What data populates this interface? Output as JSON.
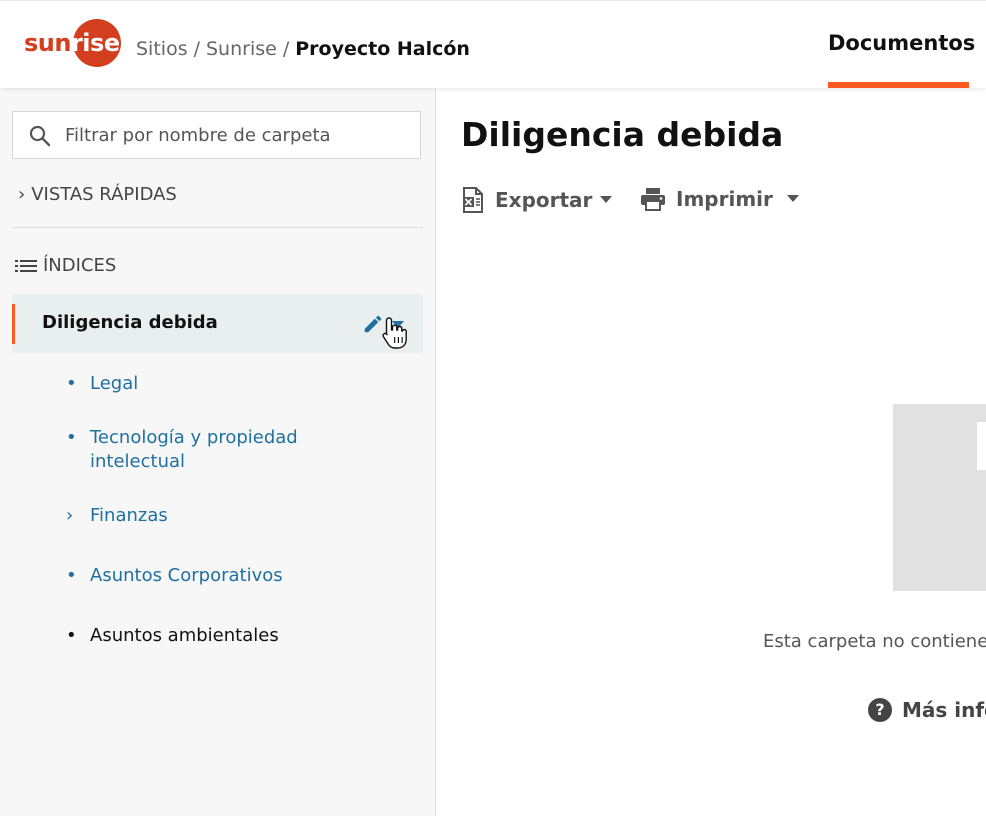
{
  "header": {
    "logo_text_left": "sun",
    "logo_text_right": "rise",
    "breadcrumb": {
      "sites": "Sitios",
      "site": "Sunrise",
      "current": "Proyecto Halcón",
      "separator": "/"
    },
    "tab_label": "Documentos",
    "brand_color": "#d23e1e",
    "accent_color": "#ff5a1f"
  },
  "sidebar": {
    "search_placeholder": "Filtrar por nombre de carpeta",
    "quick_views_label": "VISTAS RÁPIDAS",
    "indices_label": "ÍNDICES",
    "active_item": {
      "label": "Diligencia debida",
      "icons": [
        "pencil-icon",
        "caret-down-icon"
      ]
    },
    "items": [
      {
        "label": "Legal",
        "marker": "•"
      },
      {
        "label": "Tecnología y propiedad intelectual",
        "marker": "•"
      },
      {
        "label": "Finanzas",
        "marker": "›"
      },
      {
        "label": "Asuntos Corporativos",
        "marker": "•"
      },
      {
        "label": "Asuntos ambientales",
        "marker": "•"
      }
    ]
  },
  "main": {
    "title": "Diligencia debida",
    "toolbar": {
      "export_label": "Exportar",
      "print_label": "Imprimir"
    },
    "empty_text": "Esta carpeta no contiene",
    "more_info": "Más info"
  }
}
